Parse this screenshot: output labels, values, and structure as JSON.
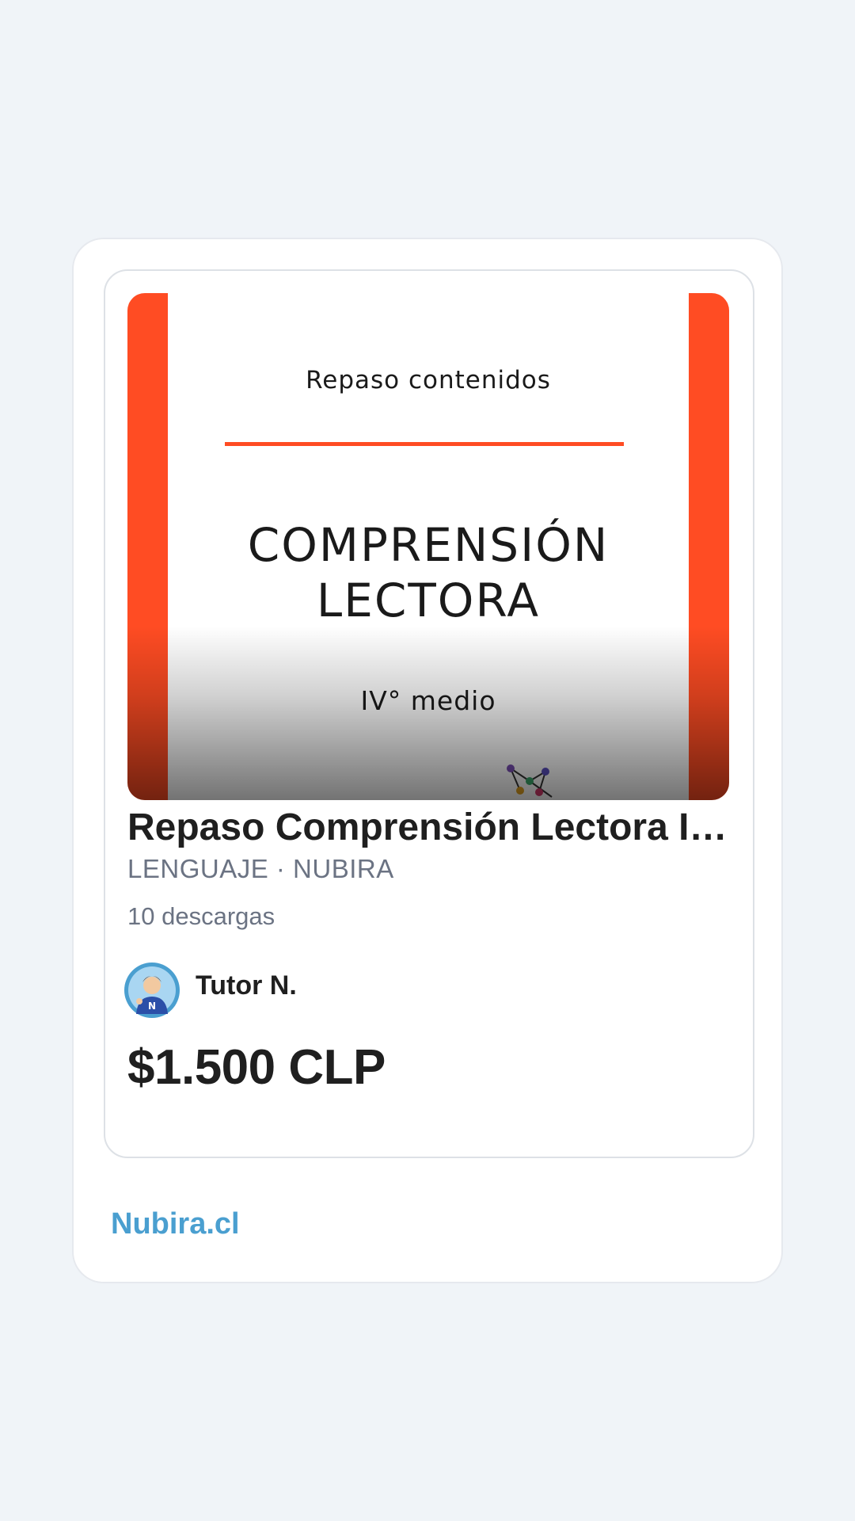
{
  "product": {
    "thumbnail": {
      "subtitle": "Repaso contenidos",
      "title_line1": "COMPRENSIÓN",
      "title_line2": "LECTORA",
      "level": "IV° medio",
      "accent_color": "#ff4c23"
    },
    "title": "Repaso Comprensión Lectora IV° medio",
    "meta": "LENGUAJE · NUBIRA",
    "downloads": "10 descargas",
    "author": {
      "name": "Tutor N.",
      "avatar_icon": "tutor-avatar-icon"
    },
    "price": "$1.500 CLP"
  },
  "footer": {
    "brand_link": "Nubira.cl",
    "brand_color": "#4a9fd0"
  }
}
